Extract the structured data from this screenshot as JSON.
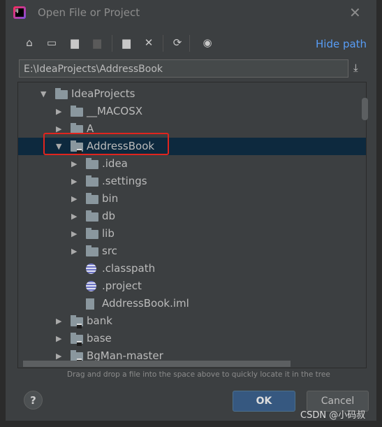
{
  "dialog": {
    "title": "Open File or Project",
    "hide_path": "Hide path",
    "path": "E:\\IdeaProjects\\AddressBook",
    "hint": "Drag and drop a file into the space above to quickly locate it in the tree",
    "ok": "OK",
    "cancel": "Cancel",
    "help": "?"
  },
  "toolbar": [
    "home-icon",
    "desktop-icon",
    "project-folder-icon",
    "module-folder-icon",
    "new-folder-icon",
    "delete-icon",
    "refresh-icon",
    "show-hidden-icon"
  ],
  "tree": [
    {
      "label": "IdeaProjects",
      "depth": 0,
      "expander": "open",
      "icon": "folder"
    },
    {
      "label": "__MACOSX",
      "depth": 1,
      "expander": "closed",
      "icon": "folder"
    },
    {
      "label": "A",
      "depth": 1,
      "expander": "closed",
      "icon": "folder"
    },
    {
      "label": "AddressBook",
      "depth": 1,
      "expander": "open",
      "icon": "module",
      "selected": true
    },
    {
      "label": ".idea",
      "depth": 2,
      "expander": "closed",
      "icon": "folder"
    },
    {
      "label": ".settings",
      "depth": 2,
      "expander": "closed",
      "icon": "folder"
    },
    {
      "label": "bin",
      "depth": 2,
      "expander": "closed",
      "icon": "folder"
    },
    {
      "label": "db",
      "depth": 2,
      "expander": "closed",
      "icon": "folder"
    },
    {
      "label": "lib",
      "depth": 2,
      "expander": "closed",
      "icon": "folder"
    },
    {
      "label": "src",
      "depth": 2,
      "expander": "closed",
      "icon": "folder"
    },
    {
      "label": ".classpath",
      "depth": 2,
      "expander": "none",
      "icon": "eclipse"
    },
    {
      "label": ".project",
      "depth": 2,
      "expander": "none",
      "icon": "eclipse"
    },
    {
      "label": "AddressBook.iml",
      "depth": 2,
      "expander": "none",
      "icon": "iml"
    },
    {
      "label": "bank",
      "depth": 1,
      "expander": "closed",
      "icon": "module"
    },
    {
      "label": "base",
      "depth": 1,
      "expander": "closed",
      "icon": "module"
    },
    {
      "label": "BgMan-master",
      "depth": 1,
      "expander": "closed",
      "icon": "module"
    }
  ],
  "watermark": "CSDN @小码叔"
}
